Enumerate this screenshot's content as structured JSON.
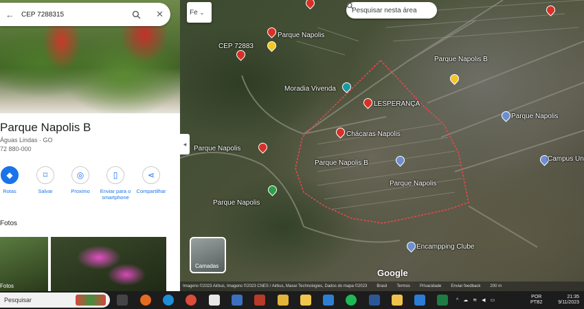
{
  "panel": {
    "search_query": "CEP 7288315",
    "place_name": "Parque Napolis B",
    "subtitle1": "Águas Lindas · GO",
    "subtitle2": "72 880-000",
    "actions": [
      {
        "label": "Rotas",
        "icon": "directions-icon"
      },
      {
        "label": "Salvar",
        "icon": "bookmark-icon"
      },
      {
        "label": "Proximo",
        "icon": "nearby-icon"
      },
      {
        "label": "Enviar para o smartphone",
        "icon": "send-to-phone-icon"
      },
      {
        "label": "Compartilhar",
        "icon": "share-icon"
      }
    ],
    "photos_title": "Fotos",
    "photo_caption": "Fotos"
  },
  "map": {
    "search_placeholder": "Pesquisar nesta área",
    "small_button": "Fe",
    "layers_label": "Camadas",
    "google": "Google",
    "attribution": "Imagens ©2023 Airbus, Imagens ©2023 CNES / Airbus, Maxar Technologies, Dados do mapa ©2023",
    "attribution_links": [
      "Brasil",
      "Termos",
      "Privacidade",
      "Enviar feedback",
      "200 m"
    ],
    "labels": [
      "Parque Napolis",
      "CEP 72883",
      "Parque Napolis B",
      "Moradia Vivenda",
      "LESPERANÇA",
      "Chácaras Napolis",
      "Parque Napolis",
      "Parque Napolis B",
      "Parque Napolis",
      "Parque Napolis",
      "Parque Napolis",
      "Campus Unieuro",
      "Encampping Clube"
    ]
  },
  "taskbar": {
    "search_label": "Pesquisar",
    "lang1": "POR",
    "lang2": "PTB2",
    "time": "21:35",
    "date": "9/11/2023"
  },
  "colors": {
    "boundary": "#e5484d",
    "accent": "#1a73e8",
    "pin_red": "#d93025"
  }
}
